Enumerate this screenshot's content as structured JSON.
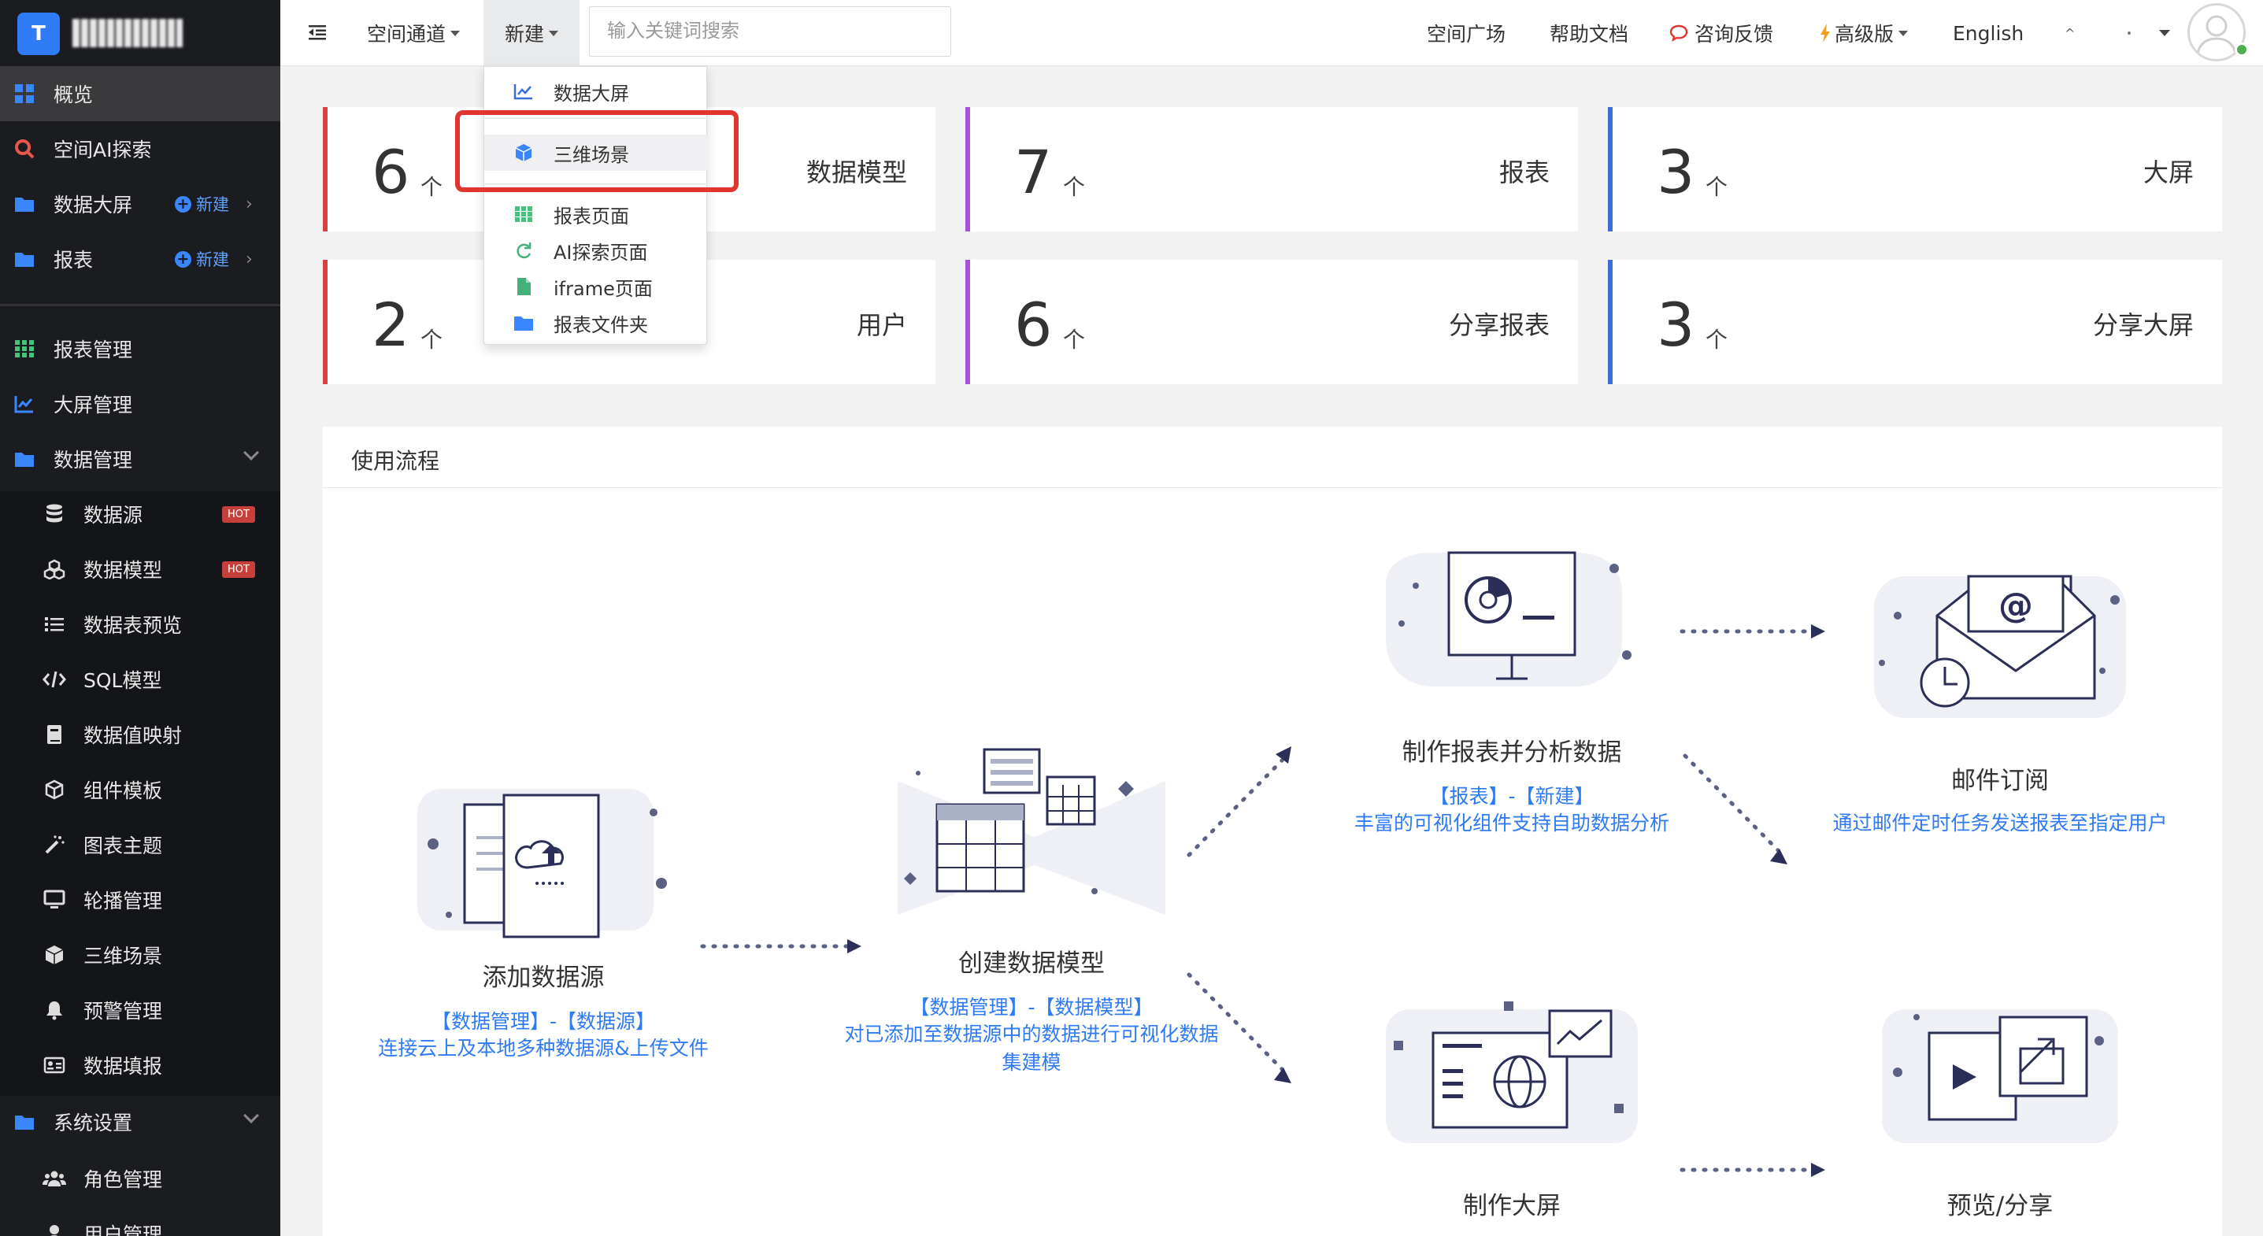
{
  "brand": {
    "initial": "T",
    "name": "tomatonazzy"
  },
  "sidebar": {
    "items": [
      {
        "label": "概览"
      },
      {
        "label": "空间AI探索"
      },
      {
        "label": "数据大屏",
        "new_label": "新建"
      },
      {
        "label": "报表",
        "new_label": "新建"
      },
      {
        "label": "报表管理"
      },
      {
        "label": "大屏管理"
      },
      {
        "label": "数据管理"
      },
      {
        "label": "数据源",
        "badge": "HOT"
      },
      {
        "label": "数据模型",
        "badge": "HOT"
      },
      {
        "label": "数据表预览"
      },
      {
        "label": "SQL模型"
      },
      {
        "label": "数据值映射"
      },
      {
        "label": "组件模板"
      },
      {
        "label": "图表主题"
      },
      {
        "label": "轮播管理"
      },
      {
        "label": "三维场景"
      },
      {
        "label": "预警管理"
      },
      {
        "label": "数据填报"
      },
      {
        "label": "系统设置"
      },
      {
        "label": "角色管理"
      },
      {
        "label": "用户管理"
      }
    ]
  },
  "header": {
    "space_channel": "空间通道",
    "new_menu": "新建",
    "search_placeholder": "输入关键词搜索",
    "space_square": "空间广场",
    "help_docs": "帮助文档",
    "feedback": "咨询反馈",
    "edition": "高级版",
    "language": "English"
  },
  "dropdown": {
    "items": [
      {
        "label": "数据大屏"
      },
      {
        "label": "三维场景"
      },
      {
        "label": "报表页面"
      },
      {
        "label": "AI探索页面"
      },
      {
        "label": "iframe页面"
      },
      {
        "label": "报表文件夹"
      }
    ]
  },
  "stats": [
    {
      "value": "6",
      "unit": "个",
      "title": "数据模型"
    },
    {
      "value": "7",
      "unit": "个",
      "title": "报表"
    },
    {
      "value": "3",
      "unit": "个",
      "title": "大屏"
    },
    {
      "value": "2",
      "unit": "个",
      "title": "用户"
    },
    {
      "value": "6",
      "unit": "个",
      "title": "分享报表"
    },
    {
      "value": "3",
      "unit": "个",
      "title": "分享大屏"
    }
  ],
  "process": {
    "title": "使用流程",
    "steps": [
      {
        "title": "添加数据源",
        "link": "【数据管理】-【数据源】",
        "desc": "连接云上及本地多种数据源&上传文件"
      },
      {
        "title": "创建数据模型",
        "link": "【数据管理】-【数据模型】",
        "desc": "对已添加至数据源中的数据进行可视化数据集建模"
      },
      {
        "title": "制作报表并分析数据",
        "link": "【报表】-【新建】",
        "desc": "丰富的可视化组件支持自助数据分析"
      },
      {
        "title": "邮件订阅",
        "desc": "通过邮件定时任务发送报表至指定用户"
      },
      {
        "title": "制作大屏"
      },
      {
        "title": "预览/分享"
      }
    ]
  },
  "colors": {
    "sidebar_bg": "#1b1c20",
    "accent_blue": "#2f7bf5",
    "card_red": "#d9453d",
    "card_purple": "#a94fd8",
    "card_blue": "#3a6fd6",
    "highlight_red": "#e0362f",
    "hot_badge": "#c63f3a"
  }
}
